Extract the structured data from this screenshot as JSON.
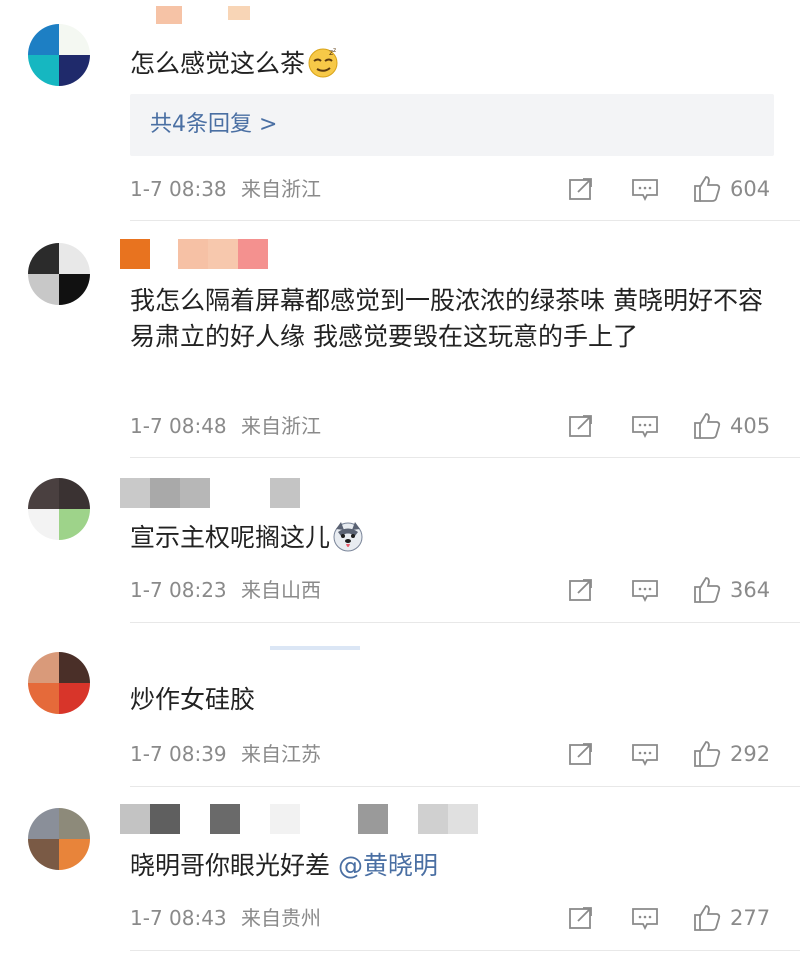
{
  "comments": [
    {
      "text": "怎么感觉这么茶",
      "emoji": "smirking-face-emoji",
      "reply_label": "共4条回复 >",
      "time": "1-7 08:38",
      "from": "来自浙江",
      "likes": "604"
    },
    {
      "text": "我怎么隔着屏幕都感觉到一股浓浓的绿茶味 黄晓明好不容易肃立的好人缘 我感觉要毁在这玩意的手上了",
      "time": "1-7 08:48",
      "from": "来自浙江",
      "likes": "405"
    },
    {
      "text": "宣示主权呢搁这儿",
      "emoji": "husky-face-emoji",
      "time": "1-7 08:23",
      "from": "来自山西",
      "likes": "364"
    },
    {
      "text": "炒作女硅胶",
      "time": "1-7 08:39",
      "from": "来自江苏",
      "likes": "292"
    },
    {
      "text": "晓明哥你眼光好差",
      "mention": "@黄晓明",
      "time": "1-7 08:43",
      "from": "来自贵州",
      "likes": "277"
    }
  ],
  "icons": {
    "share": "share-icon",
    "comment": "comment-icon",
    "like": "thumbs-up-icon"
  },
  "colors": {
    "link": "#4a6fa3",
    "meta": "#8a8a8a",
    "reply_bg": "#f3f4f6"
  }
}
